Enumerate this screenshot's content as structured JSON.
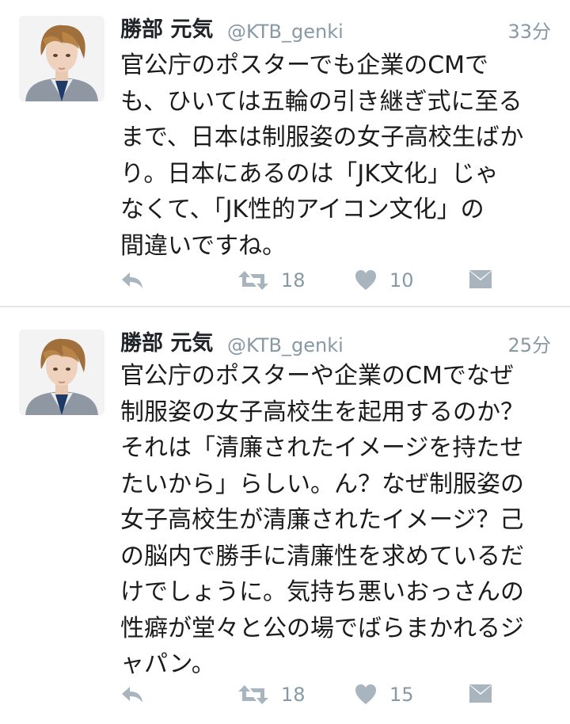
{
  "tweets": [
    {
      "display_name": "勝部 元気",
      "handle": "@KTB_genki",
      "timestamp": "33分",
      "body_lines": [
        "官公庁のポスターでも企業のCMで",
        "も、ひいては五輪の引き継ぎ式に至る",
        "まで、日本は制服姿の女子高校生ばか",
        "り。日本にあるのは「JK文化」じゃ",
        "なくて、「JK性的アイコン文化」の",
        "間違いですね。"
      ],
      "retweet_count": "18",
      "like_count": "10"
    },
    {
      "display_name": "勝部 元気",
      "handle": "@KTB_genki",
      "timestamp": "25分",
      "body_lines": [
        "官公庁のポスターや企業のCMでなぜ",
        "制服姿の女子高校生を起用するのか？",
        "それは「清廉されたイメージを持たせ",
        "たいから」らしい。ん？なぜ制服姿の",
        "女子高校生が清廉されたイメージ？己",
        "の脳内で勝手に清廉性を求めているだ",
        "けでしょうに。気持ち悪いおっさんの",
        "性癖が堂々と公の場でばらまかれるジ",
        "ャパン。"
      ],
      "retweet_count": "18",
      "like_count": "15"
    }
  ],
  "icons": {
    "reply": "reply-icon",
    "retweet": "retweet-icon",
    "like": "heart-icon",
    "dm": "direct-message-icon"
  },
  "colors": {
    "text": "#1b1b1b",
    "muted": "#8899a6",
    "icon": "#a8b5bf",
    "divider": "#e3e6e8"
  }
}
